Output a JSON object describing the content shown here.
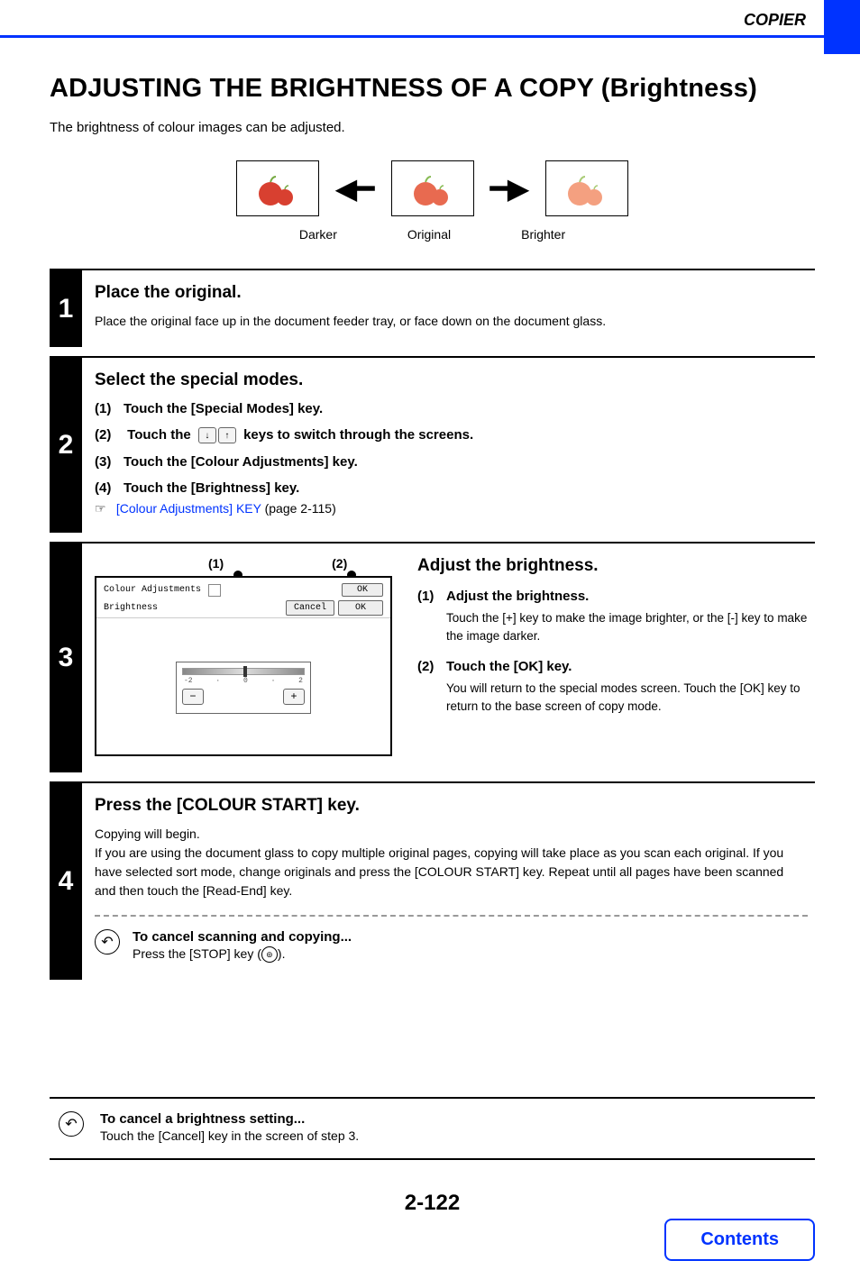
{
  "header": {
    "section": "COPIER"
  },
  "title": "ADJUSTING THE BRIGHTNESS OF A COPY (Brightness)",
  "intro": "The brightness of colour images can be adjusted.",
  "illustration": {
    "left": "Darker",
    "mid": "Original",
    "right": "Brighter"
  },
  "steps": {
    "s1": {
      "num": "1",
      "title": "Place the original.",
      "text": "Place the original face up in the document feeder tray, or face down on the document glass."
    },
    "s2": {
      "num": "2",
      "title": "Select the special modes.",
      "sub1_num": "(1)",
      "sub1": "Touch the [Special Modes] key.",
      "sub2_num": "(2)",
      "sub2_a": "Touch the",
      "sub2_b": "keys to switch through the screens.",
      "sub3_num": "(3)",
      "sub3": "Touch the [Colour Adjustments] key.",
      "sub4_num": "(4)",
      "sub4": "Touch the [Brightness] key.",
      "ref_icon": "☞",
      "ref_link": "[Colour Adjustments] KEY",
      "ref_page": " (page 2-115)"
    },
    "s3": {
      "num": "3",
      "callout1": "(1)",
      "callout2": "(2)",
      "panel": {
        "title": "Colour Adjustments",
        "ok_top": "OK",
        "sub": "Brightness",
        "cancel": "Cancel",
        "ok": "OK",
        "tick_lo": "-2",
        "tick_mid": "0",
        "tick_hi": "2",
        "minus": "−",
        "plus": "+"
      },
      "desc": {
        "title": "Adjust the brightness.",
        "d1_num": "(1)",
        "d1_title": "Adjust the brightness.",
        "d1_text": "Touch the [+] key to make the image brighter, or the [-] key to make the image darker.",
        "d2_num": "(2)",
        "d2_title": "Touch the [OK] key.",
        "d2_text": "You will return to the special modes screen. Touch the [OK] key to return to the base screen of copy mode."
      }
    },
    "s4": {
      "num": "4",
      "title": "Press the [COLOUR START] key.",
      "text1": "Copying will begin.",
      "text2": "If you are using the document glass to copy multiple original pages, copying will take place as you scan each original. If you have selected sort mode, change originals and press the [COLOUR START] key. Repeat until all pages have been scanned and then touch the [Read-End] key.",
      "cancel_title": "To cancel scanning and copying...",
      "cancel_text_a": "Press the [STOP] key (",
      "cancel_text_b": ")."
    }
  },
  "bottom_note": {
    "title": "To cancel a brightness setting...",
    "text": "Touch the [Cancel] key in the screen of step 3."
  },
  "page_number": "2-122",
  "contents_button": "Contents"
}
